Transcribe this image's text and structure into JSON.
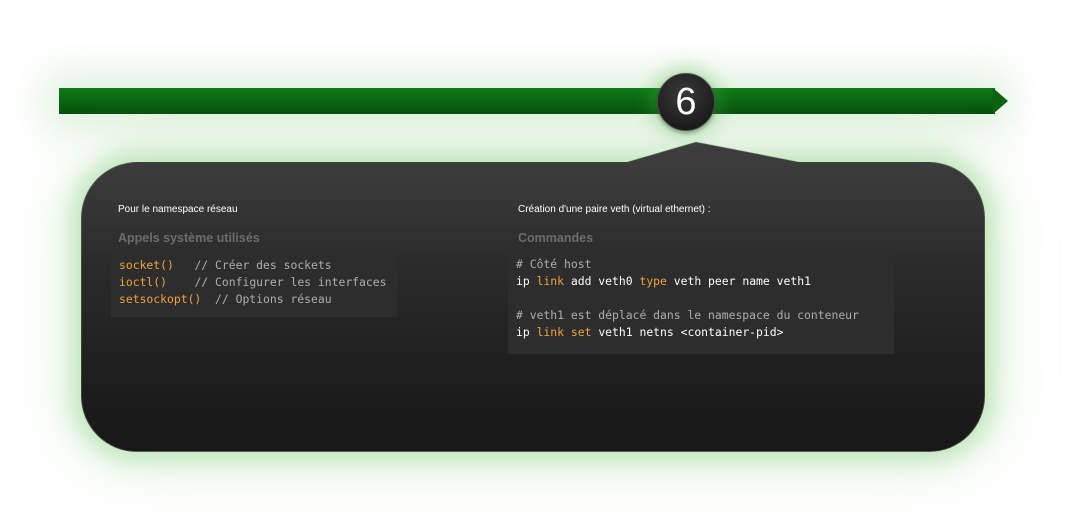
{
  "step": {
    "number": "6"
  },
  "left_column": {
    "title": "Pour le namespace réseau",
    "heading": "Appels système utilisés",
    "syscalls": [
      {
        "name": "socket()",
        "comment": "// Créer des sockets"
      },
      {
        "name": "ioctl()",
        "comment": "// Configurer les interfaces"
      },
      {
        "name": "setsockopt()",
        "comment": "// Options réseau"
      }
    ]
  },
  "right_column": {
    "title": "Création d'une paire veth (virtual ethernet) :",
    "heading": "Commandes",
    "comment_host": "# Côté host",
    "cmd1": {
      "ip": "ip",
      "link": "link",
      "add": "add veth0",
      "type": "type",
      "rest": "veth peer name veth1"
    },
    "comment_move": "# veth1 est déplacé dans le namespace du conteneur",
    "cmd2": {
      "ip": "ip",
      "link": "link",
      "set": "set",
      "rest": "veth1 netns <container-pid>"
    }
  },
  "colors": {
    "timeline_green": "#0a6312",
    "code_accent": "#f0a43a",
    "card_background": "#2b2b2b"
  }
}
